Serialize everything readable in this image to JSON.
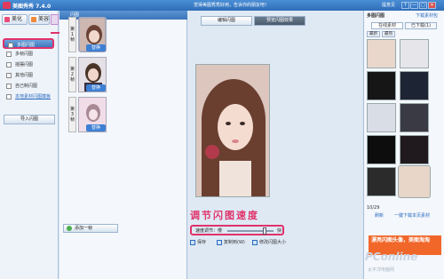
{
  "window": {
    "app_title": "美图秀秀 7.4.0",
    "hint": "觉得美图秀秀好用，告诉你的朋友吧！",
    "controls": [
      "提意见",
      "?",
      "—",
      "□",
      "✕"
    ]
  },
  "left_panel": {
    "modes": [
      {
        "label": "美化",
        "color": "#e84b7a"
      },
      {
        "label": "美容",
        "color": "#f08a3c"
      }
    ],
    "menu": [
      {
        "label": "多图闪图",
        "active": true
      },
      {
        "label": "多帧闪图",
        "active": false
      },
      {
        "label": "摇摆闪图",
        "active": false
      },
      {
        "label": "其他闪图",
        "active": false
      },
      {
        "label": "自己制闪图",
        "active": false
      },
      {
        "label": "本地素材闪图模板",
        "link": true
      }
    ],
    "import_label": "导入闪图"
  },
  "frames": {
    "header": "闪图",
    "items": [
      {
        "num": "第1帧",
        "swap": "替换"
      },
      {
        "num": "第2帧",
        "swap": "替换"
      },
      {
        "num": "第3帧",
        "swap": "替换"
      }
    ],
    "add_label": "添加一帧"
  },
  "main": {
    "tabs": [
      "编辑闪图",
      "预览闪图效果"
    ],
    "caption": "调节闪图速度",
    "speed_label": "速度调节：慢",
    "speed_fast": "快",
    "speed_value": 0.8,
    "bottom": [
      "保存",
      "复制到(W)",
      "修改闪图大小"
    ]
  },
  "right_panel": {
    "title": "多图闪图",
    "download_link": "下载素材包",
    "tabs": [
      "在线素材",
      "已下载(1)"
    ],
    "cats": [
      "最新",
      "最热"
    ],
    "page": "10/29",
    "refresh": "刷新",
    "download_all": "一键下载本页素材",
    "promo": "漂亮闪图头像，美图淘淘"
  },
  "watermark": {
    "brand": "PConline",
    "sub": "太平洋电脑网"
  },
  "colors": {
    "accent": "#3b74b8",
    "highlight": "#e0326a",
    "swap_btn": "#3d7fd3"
  }
}
